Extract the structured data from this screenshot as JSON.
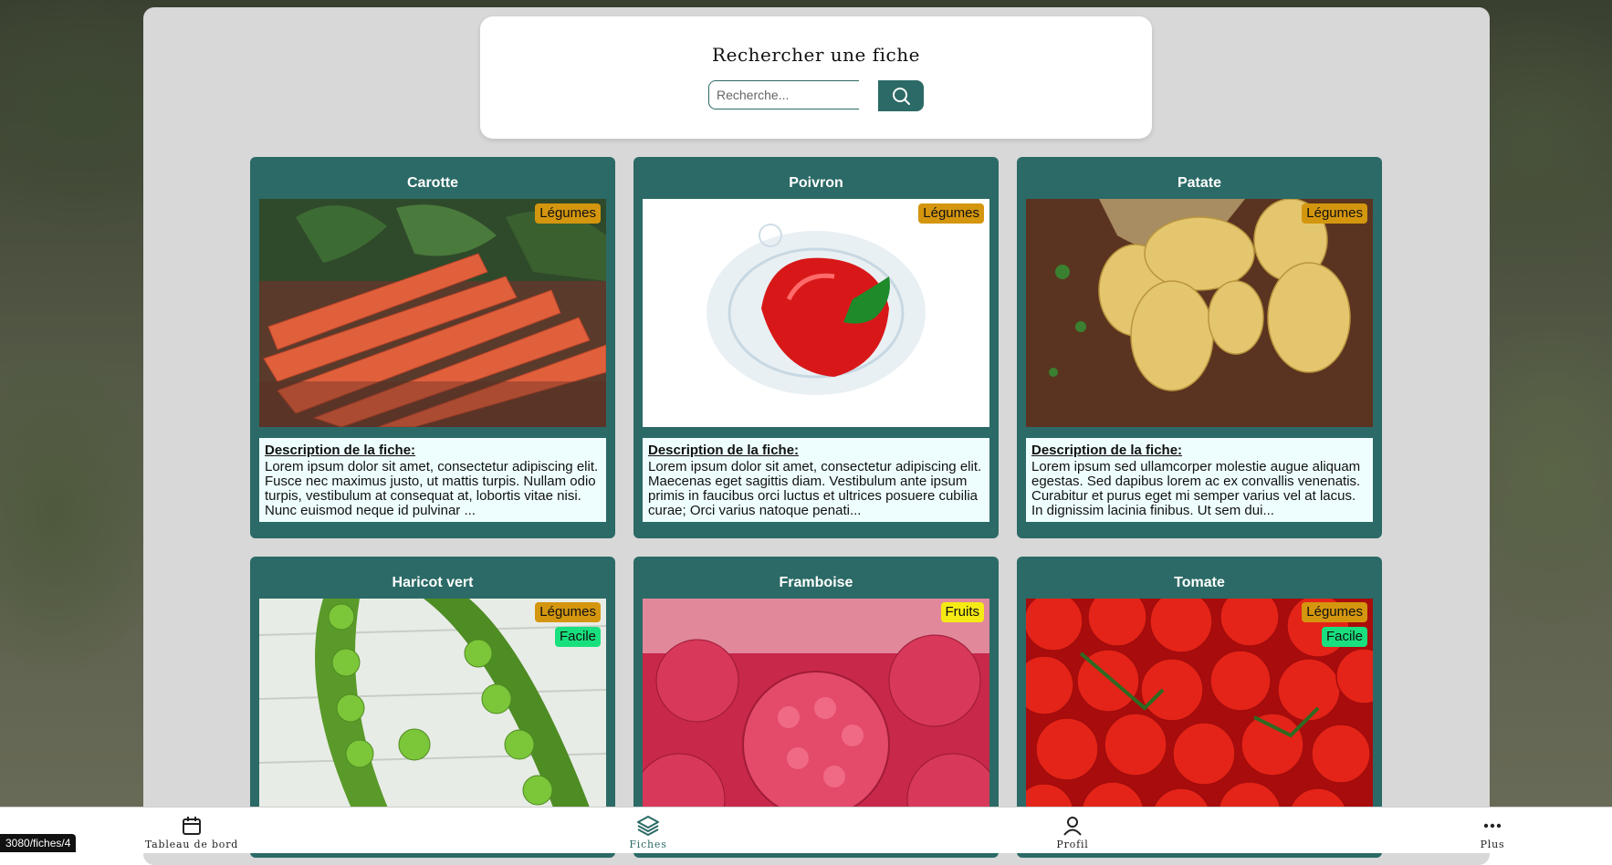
{
  "search": {
    "title": "Rechercher une fiche",
    "placeholder": "Recherche..."
  },
  "cards": [
    {
      "title": "Carotte",
      "tags": [
        "Légumes"
      ],
      "desc_heading": "Description de la fiche:",
      "description": "Lorem ipsum dolor sit amet, consectetur adipiscing elit. Fusce nec maximus justo, ut mattis turpis. Nullam odio turpis, vestibulum at consequat at, lobortis vitae nisi. Nunc euismod neque id pulvinar ..."
    },
    {
      "title": "Poivron",
      "tags": [
        "Légumes"
      ],
      "desc_heading": "Description de la fiche:",
      "description": "Lorem ipsum dolor sit amet, consectetur adipiscing elit. Maecenas eget sagittis diam. Vestibulum ante ipsum primis in faucibus orci luctus et ultrices posuere cubilia curae; Orci varius natoque penati..."
    },
    {
      "title": "Patate",
      "tags": [
        "Légumes"
      ],
      "desc_heading": "Description de la fiche:",
      "description": "Lorem ipsum sed ullamcorper molestie augue aliquam egestas. Sed dapibus lorem ac ex convallis venenatis. Curabitur et purus eget mi semper varius vel at lacus. In dignissim lacinia finibus. Ut sem dui..."
    },
    {
      "title": "Haricot vert",
      "tags": [
        "Légumes",
        "Facile"
      ]
    },
    {
      "title": "Framboise",
      "tags": [
        "Fruits"
      ]
    },
    {
      "title": "Tomate",
      "tags": [
        "Légumes",
        "Facile"
      ]
    }
  ],
  "nav": {
    "dashboard": "Tableau de bord",
    "fiches": "Fiches",
    "profil": "Profil",
    "plus": "Plus"
  },
  "status_url": "3080/fiches/4",
  "colors": {
    "primary": "#2b6a66",
    "tag_legumes": "#d4960e",
    "tag_fruits": "#f5ea14",
    "tag_facile": "#19e07e"
  }
}
